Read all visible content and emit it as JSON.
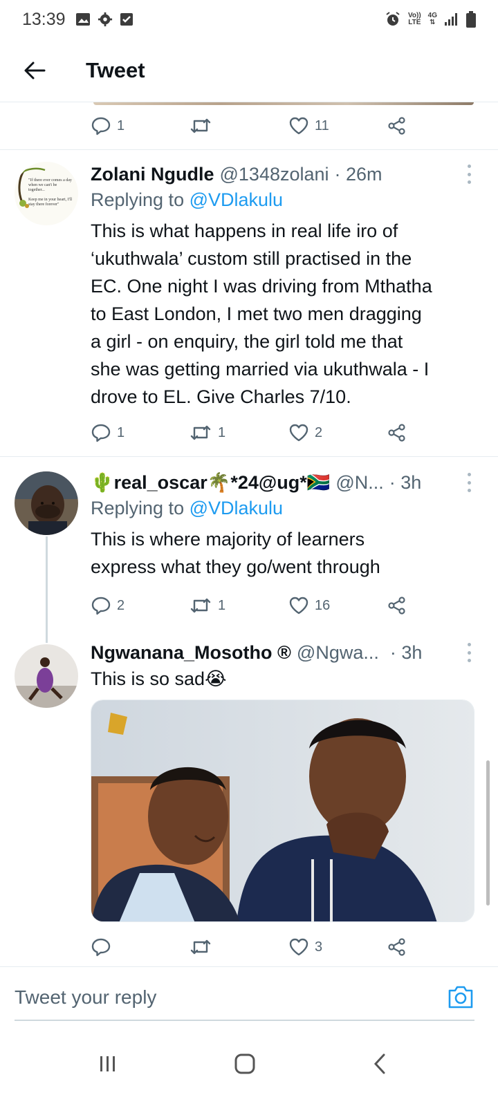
{
  "status_bar": {
    "time": "13:39",
    "network_top": "Vo))",
    "network_bottom": "LTE",
    "network2_top": "4G"
  },
  "header": {
    "title": "Tweet"
  },
  "prev_tweet_actions": {
    "replies": "1",
    "retweets": "",
    "likes": "11"
  },
  "tweets": [
    {
      "name": "Zolani Ngudle",
      "handle": "@1348zolani",
      "time": "· 26m",
      "replying_label": "Replying to ",
      "replying_to": "@VDlakulu",
      "text_lines": [
        "This is what happens in real life iro of",
        "‘ukuthwala’ custom still practised in the",
        "EC. One night I was driving from Mthatha",
        "to East London, I met two men dragging",
        "a girl - on enquiry, the girl told me that",
        "she was getting married via ukuthwala - I",
        "drove to EL. Give Charles 7/10."
      ],
      "avatar_text": [
        "\"If there ever comes a day",
        "when we can't be",
        "together...",
        "Keep me in your heart, I'll",
        "stay there forever\""
      ],
      "replies": "1",
      "retweets": "1",
      "likes": "2"
    },
    {
      "name": "🌵real_oscar🌴*24@ug*🇿🇦",
      "handle": "@N...",
      "time": "· 3h",
      "replying_label": "Replying to ",
      "replying_to": "@VDlakulu",
      "text_lines": [
        "This is where majority of learners",
        "express what they go/went through"
      ],
      "replies": "2",
      "retweets": "1",
      "likes": "16"
    },
    {
      "name": "Ngwanana_Mosotho ®",
      "handle": "@Ngwa...",
      "time": "· 3h",
      "text": "This is so sad😭",
      "replies": "",
      "retweets": "",
      "likes": "3"
    }
  ],
  "composer": {
    "placeholder": "Tweet your reply"
  },
  "colors": {
    "accent": "#1d9bf0",
    "muted": "#536471",
    "divider": "#e6ecf0"
  }
}
